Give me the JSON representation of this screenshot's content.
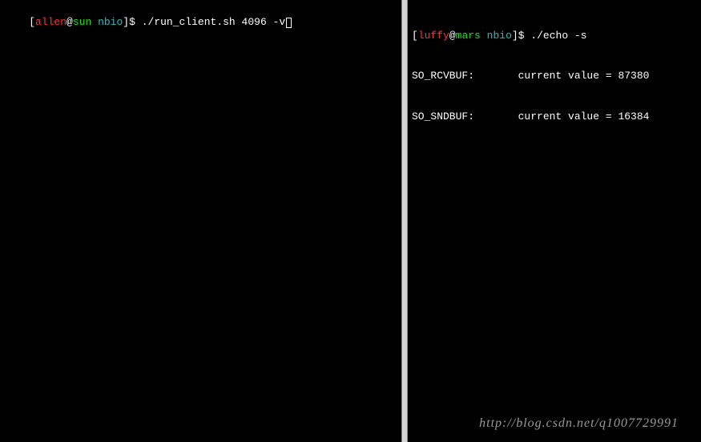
{
  "left_terminal": {
    "prompt": {
      "bracket_open": "[",
      "user": "allen",
      "at": "@",
      "host": "sun",
      "space1": " ",
      "dir": "nbio",
      "bracket_close": "]",
      "dollar": "$ "
    },
    "command": "./run_client.sh 4096 -v"
  },
  "right_terminal": {
    "prompt": {
      "bracket_open": "[",
      "user": "luffy",
      "at": "@",
      "host": "mars",
      "space1": " ",
      "dir": "nbio",
      "bracket_close": "]",
      "dollar": "$ "
    },
    "command": "./echo -s",
    "output_line1": "SO_RCVBUF:       current value = 87380",
    "output_line2": "SO_SNDBUF:       current value = 16384"
  },
  "watermark": "http://blog.csdn.net/q1007729991"
}
